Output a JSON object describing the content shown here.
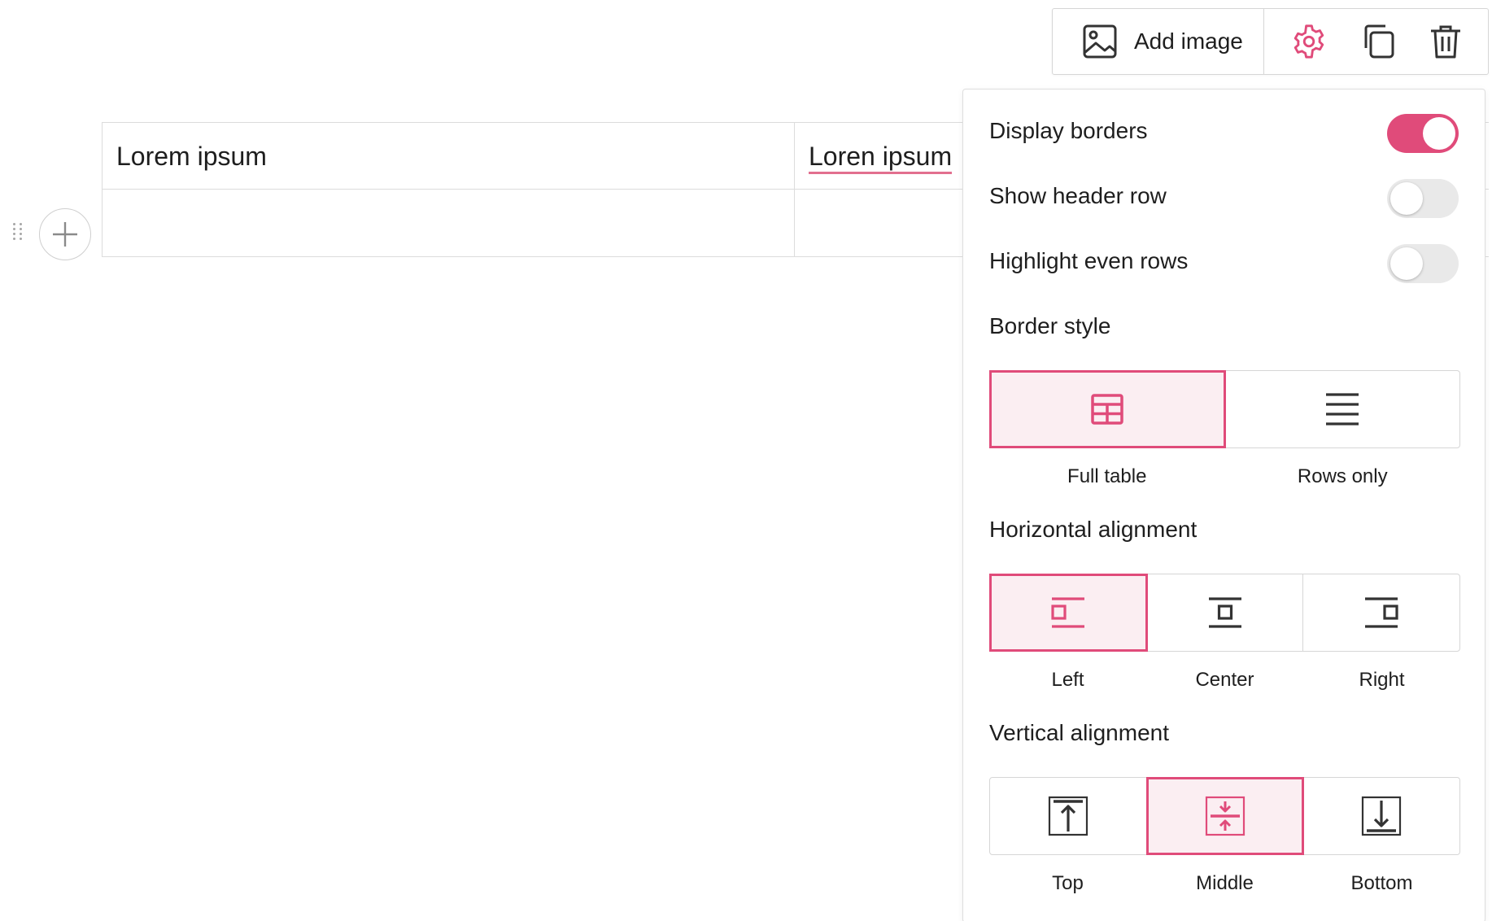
{
  "colors": {
    "accent": "#e04b7a",
    "accent_bg": "#fbeef2",
    "border": "#d6d6d6",
    "text": "#1e1e1e",
    "icon_dark": "#333333"
  },
  "table": {
    "rows": [
      [
        "Lorem ipsum",
        "Loren ipsum"
      ],
      [
        "",
        ""
      ]
    ]
  },
  "toolbar": {
    "add_image_label": "Add image",
    "icons": [
      "image-icon",
      "gear-icon",
      "duplicate-icon",
      "trash-icon"
    ]
  },
  "settings": {
    "toggles": [
      {
        "label": "Display borders",
        "on": true
      },
      {
        "label": "Show header row",
        "on": false
      },
      {
        "label": "Highlight even rows",
        "on": false
      }
    ],
    "border_style": {
      "title": "Border style",
      "options": [
        {
          "label": "Full table",
          "icon": "grid-icon",
          "active": true
        },
        {
          "label": "Rows only",
          "icon": "rows-icon",
          "active": false
        }
      ]
    },
    "horizontal_alignment": {
      "title": "Horizontal alignment",
      "options": [
        {
          "label": "Left",
          "icon": "align-left-icon",
          "active": true
        },
        {
          "label": "Center",
          "icon": "align-center-icon",
          "active": false
        },
        {
          "label": "Right",
          "icon": "align-right-icon",
          "active": false
        }
      ]
    },
    "vertical_alignment": {
      "title": "Vertical alignment",
      "options": [
        {
          "label": "Top",
          "icon": "align-top-icon",
          "active": false
        },
        {
          "label": "Middle",
          "icon": "align-middle-icon",
          "active": true
        },
        {
          "label": "Bottom",
          "icon": "align-bottom-icon",
          "active": false
        }
      ]
    }
  }
}
